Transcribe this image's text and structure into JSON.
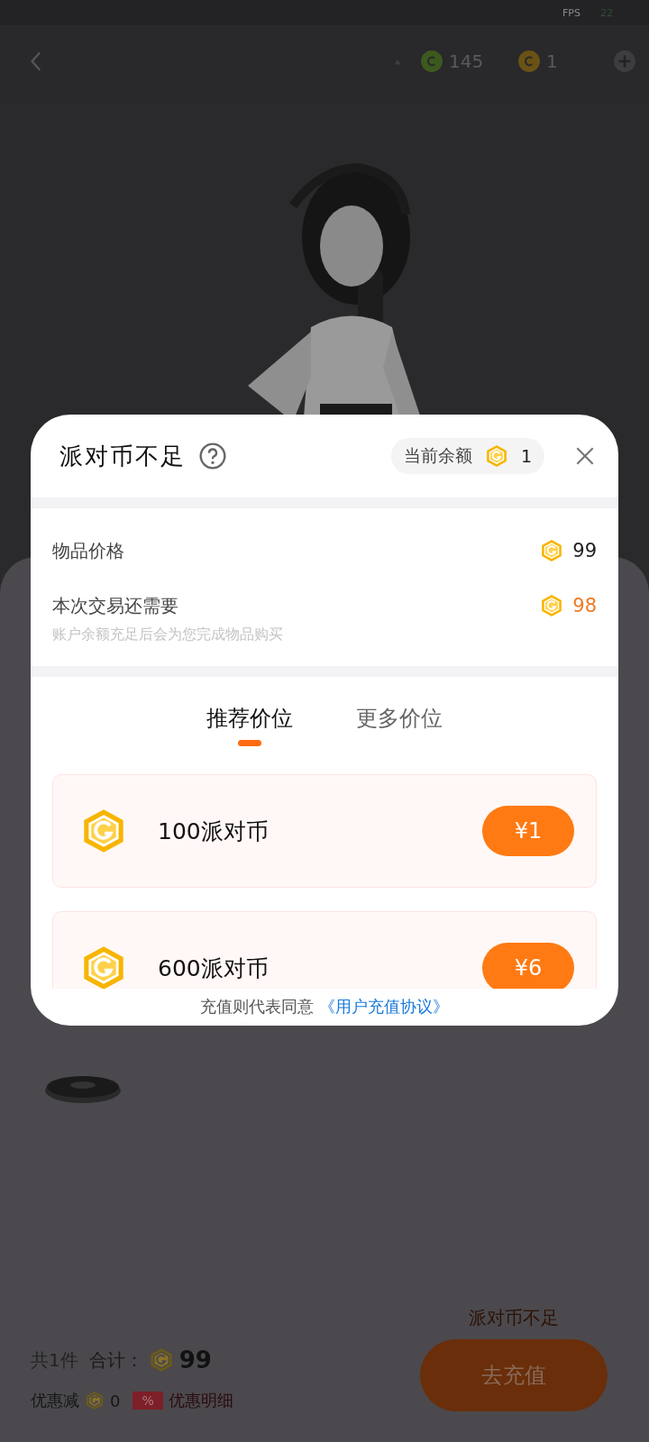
{
  "status_bar": {
    "fps_label": "FPS",
    "fps_value": "22"
  },
  "top_bar": {
    "currencies": [
      {
        "kind": "green",
        "amount": "145"
      },
      {
        "kind": "gold",
        "amount": "1"
      }
    ]
  },
  "checkout": {
    "count": "共1件",
    "total_label": "合计：",
    "total": "99",
    "discount_label": "优惠减",
    "discount": "0",
    "discount_tag": "%",
    "discount_link": "优惠明细",
    "warning": "派对币不足",
    "button": "去充值"
  },
  "dialog": {
    "title": "派对币不足",
    "balance_label": "当前余额",
    "balance": "1",
    "rows": [
      {
        "label": "物品价格",
        "amount": "99",
        "highlight": false
      },
      {
        "label": "本次交易还需要",
        "amount": "98",
        "highlight": true,
        "note": "账户余额充足后会为您完成物品购买"
      }
    ],
    "tabs": [
      {
        "label": "推荐价位",
        "selected": true
      },
      {
        "label": "更多价位",
        "selected": false
      }
    ],
    "packages": [
      {
        "name": "100派对币",
        "price": "¥1"
      },
      {
        "name": "600派对币",
        "price": "¥6"
      }
    ],
    "agreement_text": "充值则代表同意",
    "agreement_link": "《用户充值协议》"
  }
}
